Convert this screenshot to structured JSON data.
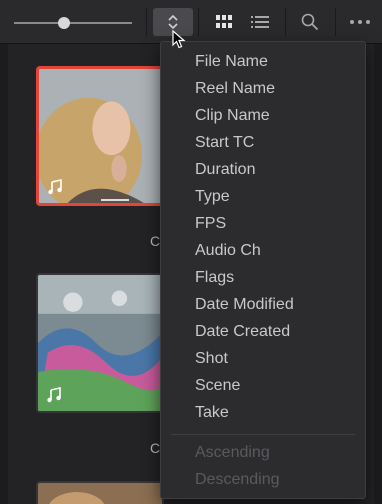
{
  "toolbar": {
    "zoom_slider": {
      "value": 0.42
    },
    "buttons": [
      {
        "name": "sort-button",
        "icon": "sort-chevrons-icon",
        "active": true
      },
      {
        "name": "thumbnail-view-button",
        "icon": "grid-icon"
      },
      {
        "name": "list-view-button",
        "icon": "list-icon"
      },
      {
        "name": "search-button",
        "icon": "search-icon"
      },
      {
        "name": "more-options-button",
        "icon": "ellipsis-icon"
      }
    ]
  },
  "bin": {
    "clips": [
      {
        "label": "C",
        "selected": true,
        "has_audio": true
      },
      {
        "label": "Cl",
        "selected": false,
        "has_audio": true
      },
      {
        "label": "",
        "selected": false,
        "has_audio": false
      }
    ]
  },
  "sort_menu": {
    "items": [
      "File Name",
      "Reel Name",
      "Clip Name",
      "Start TC",
      "Duration",
      "Type",
      "FPS",
      "Audio Ch",
      "Flags",
      "Date Modified",
      "Date Created",
      "Shot",
      "Scene",
      "Take"
    ],
    "order_items": [
      {
        "label": "Ascending",
        "enabled": false
      },
      {
        "label": "Descending",
        "enabled": false
      }
    ]
  },
  "colors": {
    "selection_border": "#e2463a",
    "menu_bg": "#2c2c2f",
    "menu_text": "#c9c9cb",
    "menu_text_disabled": "#5a5a5e"
  }
}
